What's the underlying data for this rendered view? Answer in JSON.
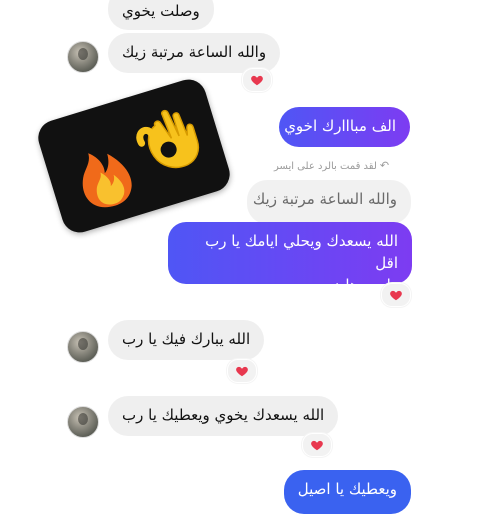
{
  "messages": {
    "top_partial": "وصلت يخوي",
    "received_1": "والله الساعة مرتبة زيك",
    "sent_1": "الف مبااارك اخوي",
    "reply_note": "لقد قمت بالرد على ايسر",
    "quoted_text": "والله الساعة مرتبة زيك",
    "sent_2_line1": "الله يسعدك ويحلي ايامك يا رب اقل",
    "sent_2_line2": "واجب هاض",
    "received_2": "الله يبارك فيك يا رب",
    "received_3": "الله يسعدك يخوي ويعطيك يا رب",
    "sent_3": "ويعطيك يا اصيل"
  },
  "icons": {
    "reaction": "heart-icon",
    "reply": "reply-arrow-icon",
    "sticker": "fire-and-ok-hand-sticker"
  },
  "colors": {
    "incoming_bubble": "#efefef",
    "outgoing_gradient_start": "#4f56f5",
    "outgoing_gradient_end": "#7d3cf2",
    "outgoing_solid": "#3a62f0",
    "heart": "#e8384f"
  }
}
